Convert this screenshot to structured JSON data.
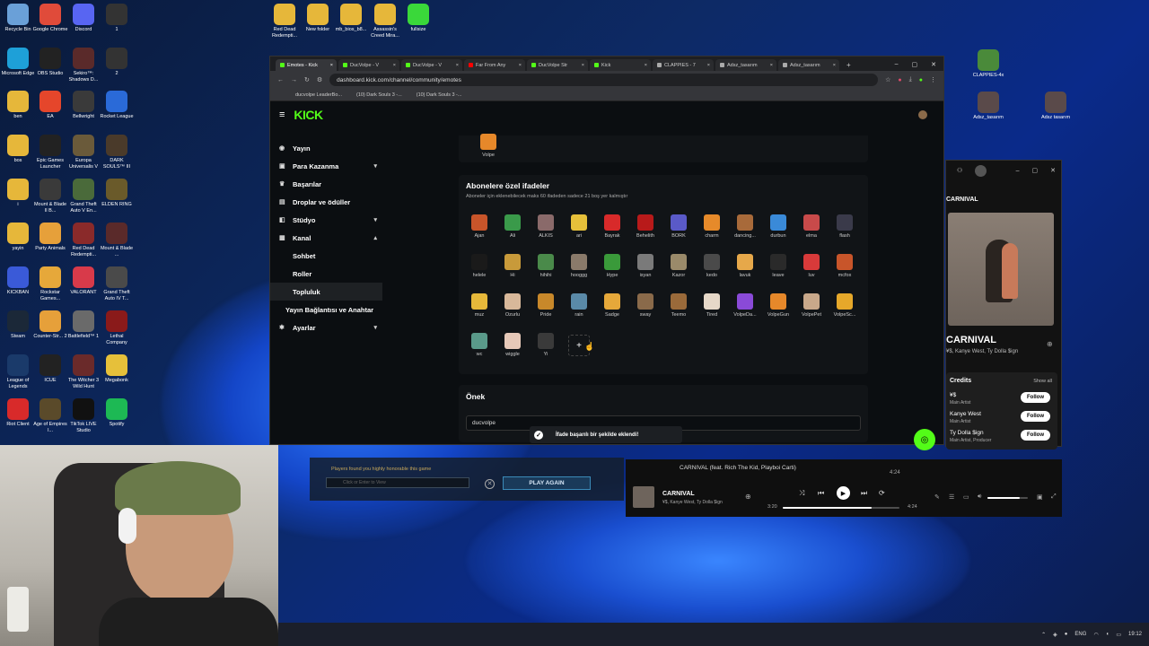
{
  "desktop": {
    "icons": [
      {
        "label": "Recycle Bin",
        "color": "#6aa0d8"
      },
      {
        "label": "Google Chrome",
        "color": "#e04b3a"
      },
      {
        "label": "Discord",
        "color": "#5865f2"
      },
      {
        "label": "1",
        "color": "#333333"
      },
      {
        "label": "Microsoft Edge",
        "color": "#1ea0d8"
      },
      {
        "label": "OBS Studio",
        "color": "#222222"
      },
      {
        "label": "Sekiro™: Shadows D...",
        "color": "#5a2a2a"
      },
      {
        "label": "2",
        "color": "#333333"
      },
      {
        "label": "ben",
        "color": "#e6b73a"
      },
      {
        "label": "EA",
        "color": "#e5462b"
      },
      {
        "label": "Bellwright",
        "color": "#3a3a3a"
      },
      {
        "label": "Rocket League",
        "color": "#2a6ad8"
      },
      {
        "label": "bos",
        "color": "#e6b73a"
      },
      {
        "label": "Epic Games Launcher",
        "color": "#222222"
      },
      {
        "label": "Europa Universalis V",
        "color": "#6a5a3a"
      },
      {
        "label": "DARK SOULS™ III",
        "color": "#4a3a2a"
      },
      {
        "label": "i",
        "color": "#e6b73a"
      },
      {
        "label": "Mount & Blade II B...",
        "color": "#3a3a3a"
      },
      {
        "label": "Grand Theft Auto V En...",
        "color": "#4a6a3a"
      },
      {
        "label": "ELDEN RING",
        "color": "#6a5a2a"
      },
      {
        "label": "yayin",
        "color": "#e6b73a"
      },
      {
        "label": "Party Animals",
        "color": "#e6a03a"
      },
      {
        "label": "Red Dead Redempti...",
        "color": "#8a2a2a"
      },
      {
        "label": "Mount & Blade ...",
        "color": "#5a2a2a"
      },
      {
        "label": "KICKBAN",
        "color": "#3a5ad8"
      },
      {
        "label": "Rockstar Games...",
        "color": "#e6a83a"
      },
      {
        "label": "VALORANT",
        "color": "#d83a4a"
      },
      {
        "label": "Grand Theft Auto IV T...",
        "color": "#4a4a4a"
      },
      {
        "label": "Steam",
        "color": "#1b2838"
      },
      {
        "label": "Counter-Str... 2",
        "color": "#e6a03a"
      },
      {
        "label": "Battlefield™ 1",
        "color": "#6a6a6a"
      },
      {
        "label": "Lethal Company",
        "color": "#8a1a1a"
      },
      {
        "label": "League of Legends",
        "color": "#1a3a6a"
      },
      {
        "label": "ICUE",
        "color": "#222222"
      },
      {
        "label": "The Witcher 3 Wild Hunt",
        "color": "#6a2a2a"
      },
      {
        "label": "Megabonk",
        "color": "#e6c03a"
      },
      {
        "label": "Riot Client",
        "color": "#d82a2a"
      },
      {
        "label": "Age of Empires I...",
        "color": "#5a4a2a"
      },
      {
        "label": "TikTok LIVE Studio",
        "color": "#111111"
      },
      {
        "label": "Spotify",
        "color": "#1db954"
      }
    ],
    "top_icons": [
      {
        "label": "Red Dead Redempti...",
        "color": "#e6b73a"
      },
      {
        "label": "New folder",
        "color": "#e6b73a"
      },
      {
        "label": "mb_bios_b8...",
        "color": "#e6b73a"
      },
      {
        "label": "Assassin's Creed Mira...",
        "color": "#e6b73a"
      },
      {
        "label": "fullsize",
        "color": "#3ad83a"
      }
    ],
    "right_icons": [
      {
        "label": "CLAPPIES-4x",
        "color": "#4a8a3a"
      },
      {
        "label": "Adsz_tasarım",
        "color": "#5a4a4a"
      },
      {
        "label": "Adsz tasarım",
        "color": "#5a4a4a"
      }
    ]
  },
  "browser": {
    "tabs": [
      "Emotes - Kick",
      "DucVolpe - V",
      "DucVolpe - V",
      "Far From Any",
      "DucVolpe Str",
      "Kick",
      "CLAPPIES - 7",
      "Adsz_tasarım",
      "Adsz_tasarım"
    ],
    "url": "dashboard.kick.com/channel/community/emotes",
    "bookmarks": [
      "ducvolpe LeaderBo...",
      "(10) Dark Souls 3 -...",
      "(10) Dark Souls 3 -..."
    ]
  },
  "kick": {
    "logo": "KICK",
    "sidebar": [
      {
        "label": "Yayın",
        "icon": "broadcast-icon",
        "chevron": ""
      },
      {
        "label": "Para Kazanma",
        "icon": "money-icon",
        "chevron": "▾"
      },
      {
        "label": "Başarılar",
        "icon": "trophy-icon",
        "chevron": ""
      },
      {
        "label": "Droplar ve ödüller",
        "icon": "gift-icon",
        "chevron": ""
      },
      {
        "label": "Stüdyo",
        "icon": "studio-icon",
        "chevron": "▾"
      },
      {
        "label": "Kanal",
        "icon": "channel-icon",
        "chevron": "▴"
      },
      {
        "label": "Sohbet",
        "icon": "",
        "chevron": ""
      },
      {
        "label": "Roller",
        "icon": "",
        "chevron": ""
      },
      {
        "label": "Topluluk",
        "icon": "",
        "chevron": ""
      },
      {
        "label": "Yayın Bağlantısı ve Anahtar",
        "icon": "",
        "chevron": ""
      },
      {
        "label": "Ayarlar",
        "icon": "settings-icon",
        "chevron": "▾"
      }
    ],
    "top_emote_label": "Volpe",
    "subs_title": "Abonelere özel ifadeler",
    "subs_subtitle": "Aboneler için eklenebilecek maks 60 ifadeden sadece 21 boş yer kalmıştır",
    "emotes": [
      {
        "name": "Ajan",
        "color": "#c8552a"
      },
      {
        "name": "Ali",
        "color": "#3a9a4a"
      },
      {
        "name": "ALKIS",
        "color": "#8a6a6a"
      },
      {
        "name": "ari",
        "color": "#e6c03a"
      },
      {
        "name": "Bayrak",
        "color": "#d82a2a"
      },
      {
        "name": "Behelith",
        "color": "#b81a1a"
      },
      {
        "name": "BORK",
        "color": "#5a5ac8"
      },
      {
        "name": "charm",
        "color": "#e68a2a"
      },
      {
        "name": "dancing...",
        "color": "#a86a3a"
      },
      {
        "name": "durbun",
        "color": "#3a8ad8"
      },
      {
        "name": "elma",
        "color": "#c84a4a"
      },
      {
        "name": "flash",
        "color": "#3a3a4a"
      },
      {
        "name": "helele",
        "color": "#1a1a1a"
      },
      {
        "name": "Hi",
        "color": "#c89a3a"
      },
      {
        "name": "hihihi",
        "color": "#4a8a4a"
      },
      {
        "name": "hooggg",
        "color": "#8a7a6a"
      },
      {
        "name": "Hype",
        "color": "#3a9a3a"
      },
      {
        "name": "isyan",
        "color": "#7a7a7a"
      },
      {
        "name": "Kazor",
        "color": "#9a8a6a"
      },
      {
        "name": "kedo",
        "color": "#4a4a4a"
      },
      {
        "name": "lavuk",
        "color": "#e6a84a"
      },
      {
        "name": "leave",
        "color": "#2a2a2a"
      },
      {
        "name": "luv",
        "color": "#d83a3a"
      },
      {
        "name": "mcfox",
        "color": "#c8552a"
      },
      {
        "name": "muz",
        "color": "#e6b83a"
      },
      {
        "name": "Ozurlu",
        "color": "#d8b89a"
      },
      {
        "name": "Pride",
        "color": "#c8882a"
      },
      {
        "name": "rain",
        "color": "#5a8aa8"
      },
      {
        "name": "Sadge",
        "color": "#e6a83a"
      },
      {
        "name": "sway",
        "color": "#8a6a4a"
      },
      {
        "name": "Teemo",
        "color": "#9a6a3a"
      },
      {
        "name": "Tired",
        "color": "#e6d8c8"
      },
      {
        "name": "VolpeDa...",
        "color": "#8a4ad8"
      },
      {
        "name": "VolpeGun",
        "color": "#e6882a"
      },
      {
        "name": "VolpePet",
        "color": "#c8a88a"
      },
      {
        "name": "VolpeSc...",
        "color": "#e6a82a"
      },
      {
        "name": "wc",
        "color": "#5a9a8a"
      },
      {
        "name": "wiggle",
        "color": "#e6c8b8"
      },
      {
        "name": "Yi",
        "color": "#3a3a3a"
      }
    ],
    "add_label": "+",
    "prefix_title": "Önek",
    "prefix_value": "ducvolpe",
    "toast": "İfade başarılı bir şekilde eklendi!"
  },
  "spotify": {
    "header": "CARNIVAL",
    "title": "CARNIVAL",
    "artists": "¥$, Kanye West, Ty Dolla $ign",
    "credits_label": "Credits",
    "show_all": "Show all",
    "credits": [
      {
        "name": "¥$",
        "role": "Main Artist"
      },
      {
        "name": "Kanye West",
        "role": "Main Artist"
      },
      {
        "name": "Ty Dolla $ign",
        "role": "Main Artist, Producer"
      }
    ],
    "follow": "Follow",
    "queue_track": "CARNIVAL (feat. Rich The Kid, Playboi Carti)",
    "queue_time": "4:24",
    "now_title": "CARNIVAL",
    "now_artists": "¥$, Kanye West, Ty Dolla $ign",
    "elapsed": "3:20",
    "total": "4:24",
    "progress": 0.76,
    "volume": 0.8
  },
  "game_overlay": {
    "banner": "Players found you highly honorable this game",
    "input_placeholder": "Click or Enter to View",
    "play_again": "PLAY AGAIN"
  },
  "taskbar": {
    "lang": "ENG",
    "time": "19:12"
  }
}
